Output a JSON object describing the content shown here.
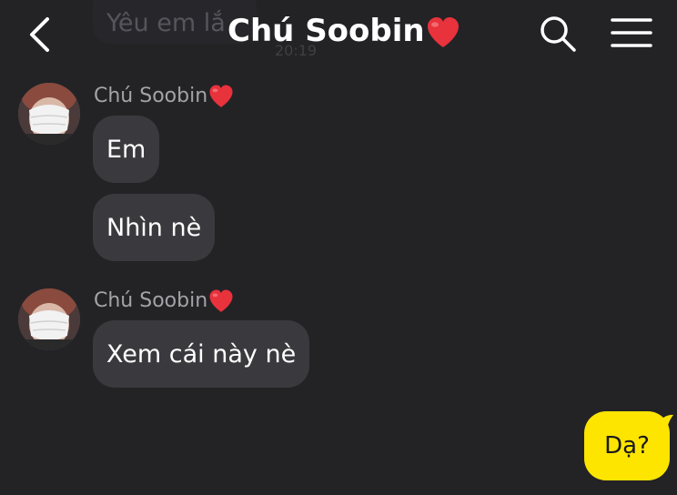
{
  "header": {
    "title": "Chú Soobin",
    "back_icon": "chevron-left-icon",
    "search_icon": "search-icon",
    "menu_icon": "hamburger-menu-icon",
    "heart_icon": "red-heart-icon"
  },
  "previous_message": {
    "text": "Yêu em lắ",
    "time": "20:19"
  },
  "groups": [
    {
      "sender": "Chú Soobin",
      "messages": [
        "Em",
        "Nhìn nè"
      ]
    },
    {
      "sender": "Chú Soobin",
      "messages": [
        "Xem cái này nè"
      ]
    }
  ],
  "my_message": "Dạ?",
  "colors": {
    "background": "#232326",
    "incoming_bubble": "#3a3a3e",
    "outgoing_bubble": "#fee500",
    "heart": "#e8323c"
  }
}
